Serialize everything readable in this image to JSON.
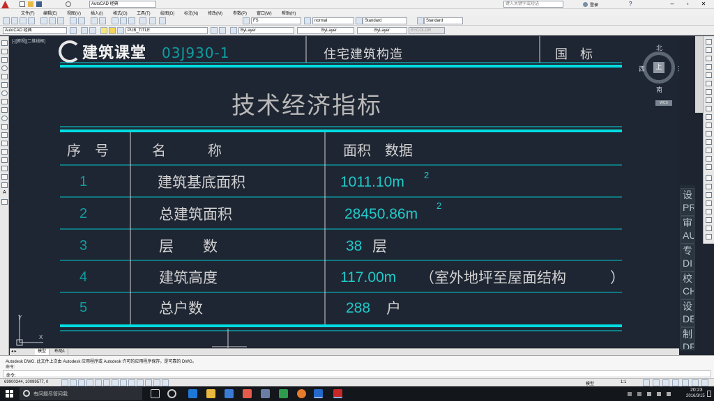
{
  "window": {
    "title": "AutoCAD 经典",
    "search_placeholder": "键入关键字或短语",
    "user_label": "登录",
    "help_label": "?"
  },
  "menus": [
    "文件(F)",
    "编辑(E)",
    "视图(V)",
    "插入(I)",
    "格式(O)",
    "工具(T)",
    "绘图(D)",
    "标注(N)",
    "修改(M)",
    "参数(P)",
    "窗口(W)",
    "帮助(H)"
  ],
  "toolbar": {
    "text_style": "FS",
    "dim_style": "normal",
    "table_style": "Standard",
    "mleader_style": "Standard",
    "workspace": "AutoCAD 经典",
    "layer": "PUB_TITLE",
    "color": "ByLayer",
    "linetype": "ByLayer",
    "lineweight": "ByLayer",
    "plotstyle": "BYCOLOR"
  },
  "viewport": {
    "label": "[-][俯视][二维线框]",
    "watermark": "建筑课堂",
    "viewcube": {
      "north": "北",
      "south": "南",
      "east": "东",
      "west": "西",
      "top": "上",
      "wcs": "WCS"
    },
    "ucs_y": "Y",
    "ucs_x": "X"
  },
  "drawing": {
    "header_code": "03J930-1",
    "header_title": "住宅建筑构造",
    "header_standard": "国　标",
    "table_title": "技术经济指标",
    "col_headers": [
      "序　号",
      "名　　　称",
      "面积　数据"
    ],
    "rows": [
      {
        "no": "1",
        "name": "建筑基底面积",
        "value": "1011.10m",
        "sup": "2",
        "note": ""
      },
      {
        "no": "2",
        "name": "总建筑面积",
        "value": "28450.86m",
        "sup": "2",
        "note": ""
      },
      {
        "no": "3",
        "name": "层　　数",
        "value": "38",
        "sup": "",
        "note": "层"
      },
      {
        "no": "4",
        "name": "建筑高度",
        "value": "117.00m",
        "sup": "",
        "note": "（室外地坪至屋面结构　　　）"
      },
      {
        "no": "5",
        "name": "总户数",
        "value": "288",
        "sup": "",
        "note": "户"
      }
    ]
  },
  "side_tabs": [
    "设\nPR",
    "审\nAU",
    "专\nDI",
    "校\nCH",
    "设\nDE",
    "制\nDR"
  ],
  "layout_tabs": [
    "模型",
    "布局1"
  ],
  "command": {
    "line1": "Autodesk DWG.  此文件上次由 Autodesk 应用程序或 Autodesk 许可的应用程序保存，是可靠的 DWG。",
    "line2": "命令:",
    "prompt": "命令:"
  },
  "status": {
    "coords": "69900344, 10099577, 0",
    "model": "模型",
    "scale": "1:1"
  },
  "taskbar": {
    "search_text": "有问题尽管问我",
    "time": "20:23",
    "date": "2016/3/15"
  },
  "colors": {
    "canvas": "#1f2633",
    "cyan": "#00dde2",
    "table_text": "#d4d4d4",
    "data_text": "#21c9c9"
  }
}
